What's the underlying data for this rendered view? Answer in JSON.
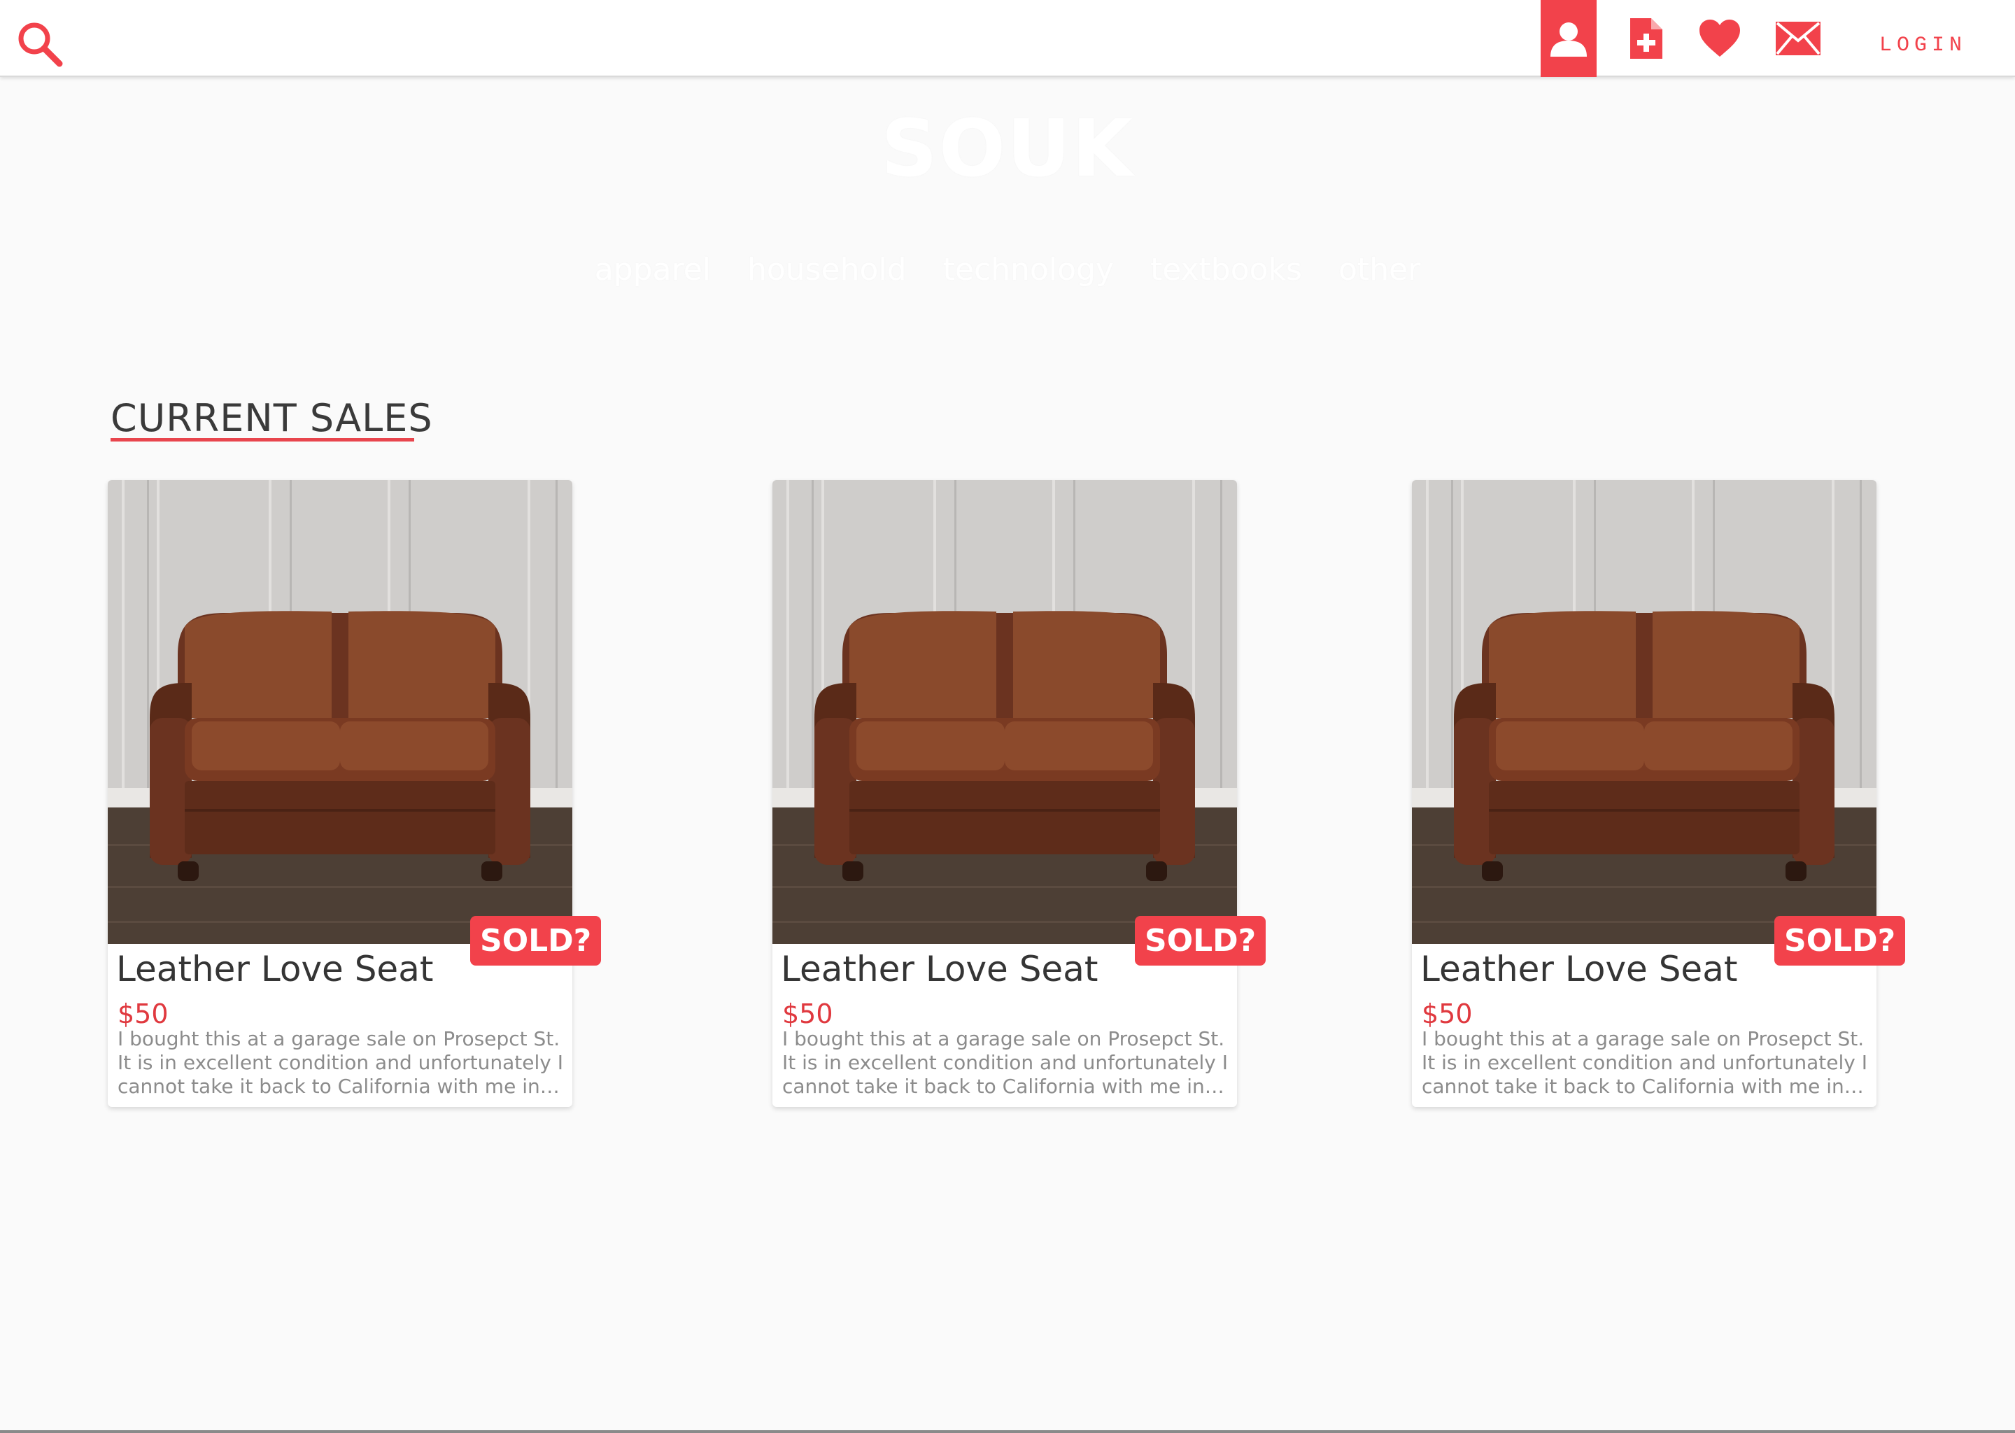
{
  "header": {
    "login_label": "LOGIN",
    "icons": [
      "search-icon",
      "profile-icon",
      "new-post-icon",
      "heart-icon",
      "mail-icon"
    ],
    "accent_color": "#f2424b"
  },
  "hero": {
    "brand": "SOUK",
    "categories": [
      "apparel",
      "household",
      "technology",
      "textbooks",
      "other"
    ]
  },
  "section": {
    "title": "CURRENT SALES"
  },
  "listings": [
    {
      "title": "Leather Love Seat",
      "price": "$50",
      "description": "I bought this at a garage sale on Prosepct St. It is in excellent condition and unfortunately I cannot take it back to California with me in…",
      "action_label": "SOLD?"
    },
    {
      "title": "Leather Love Seat",
      "price": "$50",
      "description": "I bought this at a garage sale on Prosepct St. It is in excellent condition and unfortunately I cannot take it back to California with me in…",
      "action_label": "SOLD?"
    },
    {
      "title": "Leather Love Seat",
      "price": "$50",
      "description": "I bought this at a garage sale on Prosepct St. It is in excellent condition and unfortunately I cannot take it back to California with me in…",
      "action_label": "SOLD?"
    }
  ]
}
